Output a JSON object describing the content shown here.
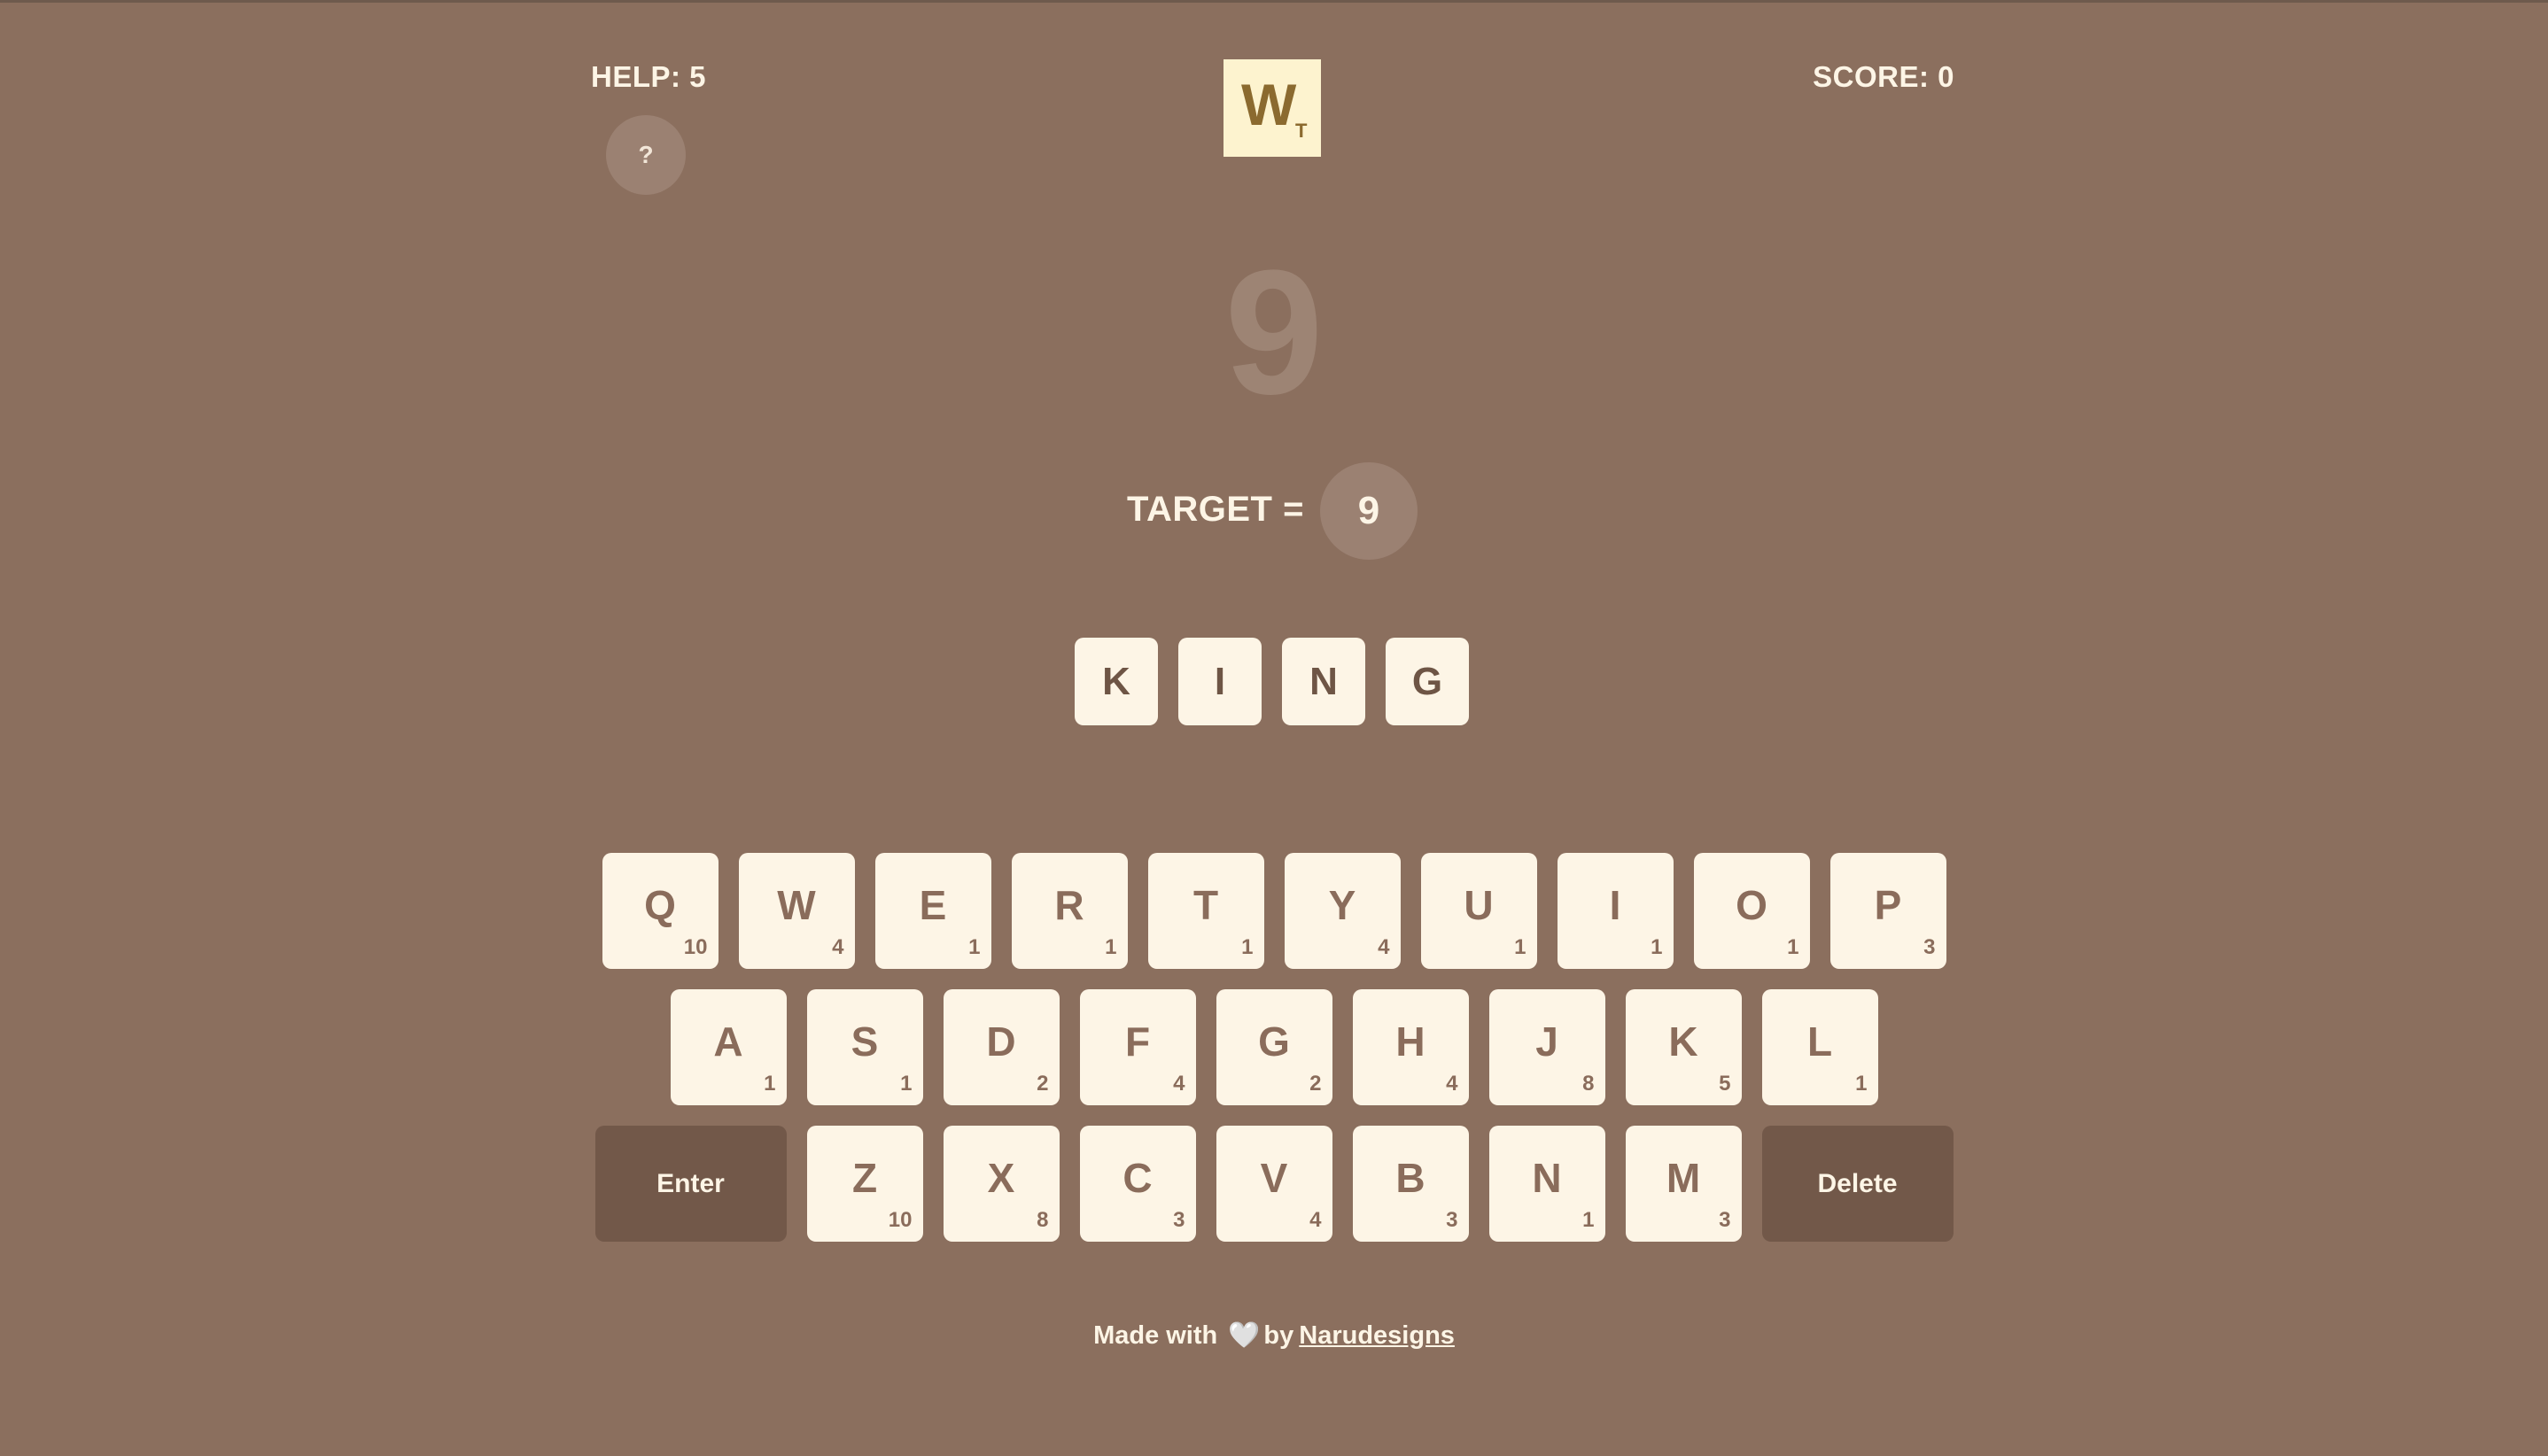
{
  "header": {
    "help_label": "HELP: 5",
    "help_button_label": "?",
    "score_label": "SCORE: 0",
    "logo_letter": "W",
    "logo_sub": "T"
  },
  "current_value": "9",
  "target": {
    "label": "TARGET =",
    "value": "9"
  },
  "word_tiles": [
    "K",
    "I",
    "N",
    "G"
  ],
  "keyboard": {
    "row1": [
      {
        "letter": "Q",
        "points": "10"
      },
      {
        "letter": "W",
        "points": "4"
      },
      {
        "letter": "E",
        "points": "1"
      },
      {
        "letter": "R",
        "points": "1"
      },
      {
        "letter": "T",
        "points": "1"
      },
      {
        "letter": "Y",
        "points": "4"
      },
      {
        "letter": "U",
        "points": "1"
      },
      {
        "letter": "I",
        "points": "1"
      },
      {
        "letter": "O",
        "points": "1"
      },
      {
        "letter": "P",
        "points": "3"
      }
    ],
    "row2": [
      {
        "letter": "A",
        "points": "1"
      },
      {
        "letter": "S",
        "points": "1"
      },
      {
        "letter": "D",
        "points": "2"
      },
      {
        "letter": "F",
        "points": "4"
      },
      {
        "letter": "G",
        "points": "2"
      },
      {
        "letter": "H",
        "points": "4"
      },
      {
        "letter": "J",
        "points": "8"
      },
      {
        "letter": "K",
        "points": "5"
      },
      {
        "letter": "L",
        "points": "1"
      }
    ],
    "row3": [
      {
        "letter": "Z",
        "points": "10"
      },
      {
        "letter": "X",
        "points": "8"
      },
      {
        "letter": "C",
        "points": "3"
      },
      {
        "letter": "V",
        "points": "4"
      },
      {
        "letter": "B",
        "points": "3"
      },
      {
        "letter": "N",
        "points": "1"
      },
      {
        "letter": "M",
        "points": "3"
      }
    ],
    "enter_label": "Enter",
    "delete_label": "Delete"
  },
  "footer": {
    "made_with": "Made with",
    "heart": "🤍",
    "by": "by",
    "author_link": "Narudesigns"
  },
  "colors": {
    "background": "#8b6f5e",
    "tile": "#fdf5e6",
    "action_key": "#725849",
    "logo_bg": "#fdf3cf"
  }
}
